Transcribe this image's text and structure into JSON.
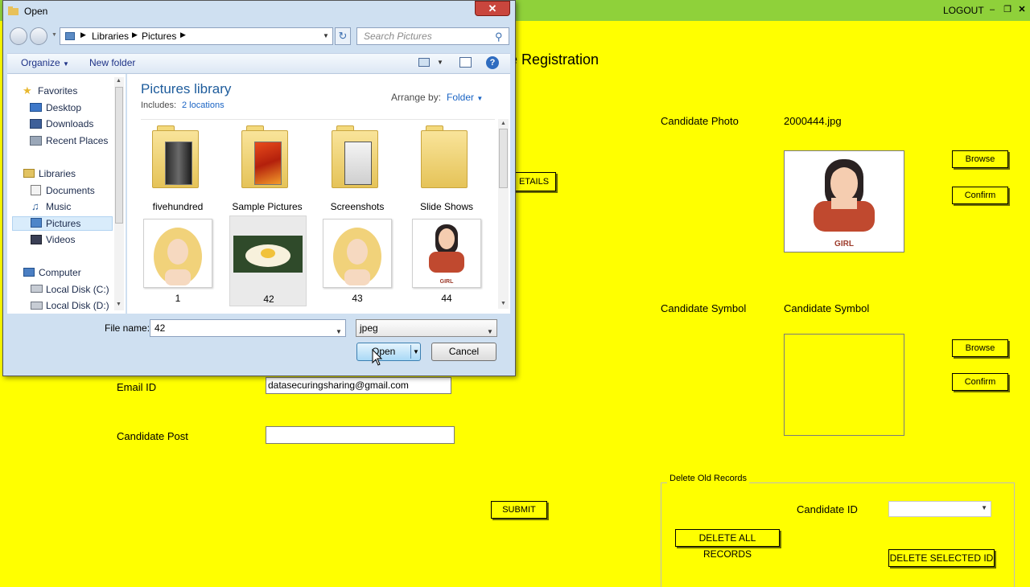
{
  "app": {
    "logout": "LOGOUT",
    "heading": "e Registration",
    "details_button": "ETAILS",
    "candidate_photo_label": "Candidate Photo",
    "photo_filename": "2000444.jpg",
    "photo_caption": "GIRL",
    "candidate_symbol_label": "Candidate Symbol",
    "candidate_symbol_value": "Candidate Symbol",
    "browse_label": "Browse",
    "confirm_label": "Confirm",
    "email_label": "Email ID",
    "email_value": "datasecuringsharing@gmail.com",
    "post_label": "Candidate Post",
    "post_value": "",
    "submit_label": "SUBMIT",
    "delete_group_title": "Delete Old Records",
    "candidate_id_label": "Candidate ID",
    "delete_all_label": "DELETE ALL RECORDS",
    "delete_selected_label": "DELETE SELECTED ID"
  },
  "dialog": {
    "title": "Open",
    "breadcrumb": [
      "Libraries",
      "Pictures"
    ],
    "search_placeholder": "Search Pictures",
    "organize_label": "Organize",
    "new_folder_label": "New folder",
    "nav": {
      "favorites": "Favorites",
      "favorites_items": [
        "Desktop",
        "Downloads",
        "Recent Places"
      ],
      "libraries": "Libraries",
      "libraries_items": [
        "Documents",
        "Music",
        "Pictures",
        "Videos"
      ],
      "computer": "Computer",
      "computer_items": [
        "Local Disk (C:)",
        "Local Disk (D:)"
      ]
    },
    "library_title": "Pictures library",
    "includes_label": "Includes:",
    "locations_link": "2 locations",
    "arrange_by_label": "Arrange by:",
    "arrange_by_value": "Folder",
    "items": [
      {
        "label": "fivehundred",
        "kind": "folder"
      },
      {
        "label": "Sample Pictures",
        "kind": "folder"
      },
      {
        "label": "Screenshots",
        "kind": "folder"
      },
      {
        "label": "Slide Shows",
        "kind": "folder"
      },
      {
        "label": "1",
        "kind": "image"
      },
      {
        "label": "42",
        "kind": "image"
      },
      {
        "label": "43",
        "kind": "image"
      },
      {
        "label": "44",
        "kind": "image"
      }
    ],
    "girl_caption": "GIRL",
    "file_name_label": "File name:",
    "file_name_value": "42",
    "file_type_value": "jpeg",
    "open_label": "Open",
    "cancel_label": "Cancel"
  },
  "colors": {
    "app_background": "#ffff00",
    "titlebar": "#8fd13a",
    "dialog_frame": "#cfe0f1",
    "link_blue": "#1a64c4"
  }
}
